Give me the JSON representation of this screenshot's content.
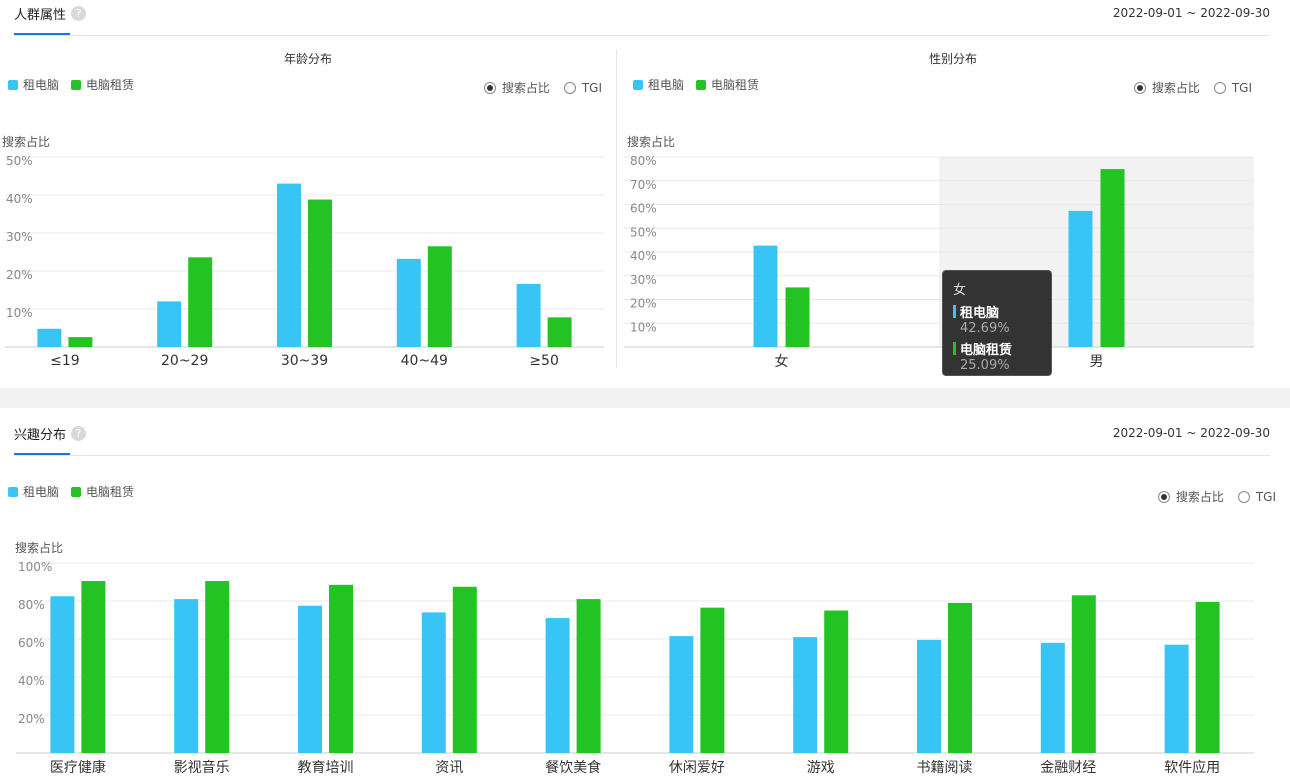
{
  "colors": {
    "series1": "#38c5f5",
    "series2": "#22c322",
    "accent": "#1a73e8"
  },
  "top_section": {
    "title": "人群属性",
    "date_range": "2022-09-01 ~ 2022-09-30"
  },
  "bottom_section": {
    "title": "兴趣分布",
    "date_range": "2022-09-01 ~ 2022-09-30"
  },
  "legend": {
    "series1": "租电脑",
    "series2": "电脑租赁"
  },
  "toggle": {
    "option1": "搜索占比",
    "option2": "TGI",
    "selected": "搜索占比"
  },
  "tooltip": {
    "title": "女",
    "items": [
      {
        "label": "租电脑",
        "value": "42.69%"
      },
      {
        "label": "电脑租赁",
        "value": "25.09%"
      }
    ]
  },
  "chart_data": [
    {
      "type": "bar",
      "title": "年龄分布",
      "ylabel": "搜索占比",
      "ylim": [
        0,
        50
      ],
      "yticks": [
        "10%",
        "20%",
        "30%",
        "40%",
        "50%"
      ],
      "categories": [
        "≤19",
        "20~29",
        "30~39",
        "40~49",
        "≥50"
      ],
      "series": [
        {
          "name": "租电脑",
          "values": [
            4.8,
            12.0,
            43.0,
            23.2,
            16.6
          ]
        },
        {
          "name": "电脑租赁",
          "values": [
            2.6,
            23.6,
            38.8,
            26.5,
            7.8
          ]
        }
      ],
      "grid": true
    },
    {
      "type": "bar",
      "title": "性别分布",
      "ylabel": "搜索占比",
      "ylim": [
        0,
        80
      ],
      "yticks": [
        "10%",
        "20%",
        "30%",
        "40%",
        "50%",
        "60%",
        "70%",
        "80%"
      ],
      "categories": [
        "女",
        "男"
      ],
      "series": [
        {
          "name": "租电脑",
          "values": [
            42.69,
            57.31
          ]
        },
        {
          "name": "电脑租赁",
          "values": [
            25.09,
            74.91
          ]
        }
      ],
      "highlighted_category": "男",
      "grid": true
    },
    {
      "type": "bar",
      "ylabel": "搜索占比",
      "ylim": [
        0,
        100
      ],
      "yticks": [
        "20%",
        "40%",
        "60%",
        "80%",
        "100%"
      ],
      "categories": [
        "医疗健康",
        "影视音乐",
        "教育培训",
        "资讯",
        "餐饮美食",
        "休闲爱好",
        "游戏",
        "书籍阅读",
        "金融财经",
        "软件应用"
      ],
      "series": [
        {
          "name": "租电脑",
          "values": [
            82.5,
            81.0,
            77.5,
            74.0,
            71.0,
            61.5,
            61.0,
            59.5,
            58.0,
            57.0
          ]
        },
        {
          "name": "电脑租赁",
          "values": [
            90.5,
            90.5,
            88.5,
            87.5,
            81.0,
            76.5,
            75.0,
            79.0,
            83.0,
            79.5
          ]
        }
      ],
      "grid": true
    }
  ]
}
